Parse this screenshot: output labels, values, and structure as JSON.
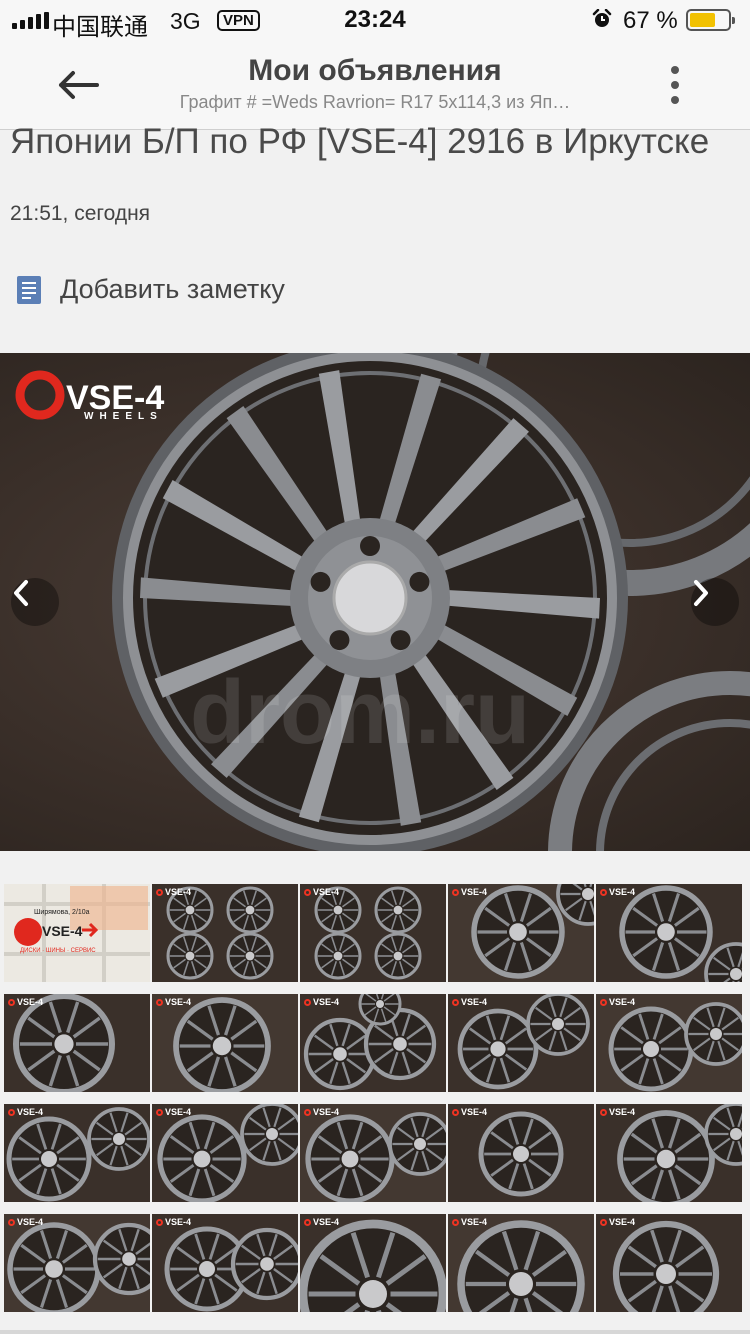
{
  "status_bar": {
    "carrier": "中国联通",
    "network": "3G",
    "vpn": "VPN",
    "time": "23:24",
    "battery": "67 %",
    "battery_level": 0.67
  },
  "nav": {
    "title": "Мои объявления",
    "subtitle": "Графит # =Weds Ravrion= R17 5x114,3 из Яп…",
    "back_icon": "arrow-left-icon",
    "menu_icon": "more-vertical-icon"
  },
  "ad": {
    "title_fragment": "Японии Б/П по РФ [VSE-4] 2916 в Иркутске",
    "time": "21:51, сегодня",
    "note_label": "Добавить заметку",
    "note_icon": "note-icon"
  },
  "photo": {
    "logo_text": "VSE-4",
    "logo_sub": "WHEELS",
    "watermark": "drom.ru",
    "prev_icon": "chevron-left-icon",
    "next_icon": "chevron-right-icon"
  },
  "thumbnails": {
    "map_text": "Ширямова, 2/10а",
    "map_brand": "VSE-4",
    "map_caption": "ДИСКИ · ШИНЫ · СЕРВИС",
    "logo_text": "VSE-4",
    "count": 20
  },
  "colors": {
    "accent_red": "#e0281e",
    "battery": "#f2c100",
    "wheel": "#8a8c90"
  }
}
